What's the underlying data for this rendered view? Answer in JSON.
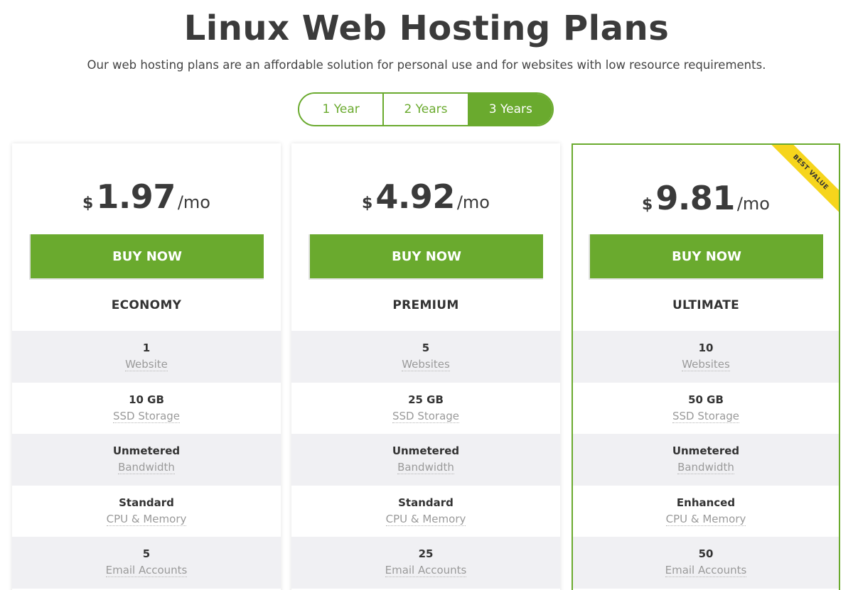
{
  "header": {
    "title": "Linux Web Hosting Plans",
    "subtitle": "Our web hosting plans are an affordable solution for personal use and for websites with low resource requirements."
  },
  "period_toggle": {
    "options": [
      "1 Year",
      "2 Years",
      "3 Years"
    ],
    "selected": "3 Years"
  },
  "plans": [
    {
      "currency": "$",
      "price": "1.97",
      "period": "/mo",
      "buy_label": "BUY NOW",
      "name": "ECONOMY",
      "features": [
        {
          "value": "1",
          "label": "Website"
        },
        {
          "value": "10 GB",
          "label": "SSD Storage"
        },
        {
          "value": "Unmetered",
          "label": "Bandwidth"
        },
        {
          "value": "Standard",
          "label": "CPU & Memory"
        },
        {
          "value": "5",
          "label": "Email Accounts"
        }
      ]
    },
    {
      "currency": "$",
      "price": "4.92",
      "period": "/mo",
      "buy_label": "BUY NOW",
      "name": "PREMIUM",
      "features": [
        {
          "value": "5",
          "label": "Websites"
        },
        {
          "value": "25 GB",
          "label": "SSD Storage"
        },
        {
          "value": "Unmetered",
          "label": "Bandwidth"
        },
        {
          "value": "Standard",
          "label": "CPU & Memory"
        },
        {
          "value": "25",
          "label": "Email Accounts"
        }
      ]
    },
    {
      "currency": "$",
      "price": "9.81",
      "period": "/mo",
      "buy_label": "BUY NOW",
      "name": "ULTIMATE",
      "badge": "BEST VALUE",
      "features": [
        {
          "value": "10",
          "label": "Websites"
        },
        {
          "value": "50 GB",
          "label": "SSD Storage"
        },
        {
          "value": "Unmetered",
          "label": "Bandwidth"
        },
        {
          "value": "Enhanced",
          "label": "CPU & Memory"
        },
        {
          "value": "50",
          "label": "Email Accounts"
        }
      ]
    }
  ],
  "colors": {
    "accent": "#6aaa2e",
    "ribbon": "#f6d51c",
    "row_shade": "#f0f0f3",
    "text": "#3a3a3a"
  }
}
